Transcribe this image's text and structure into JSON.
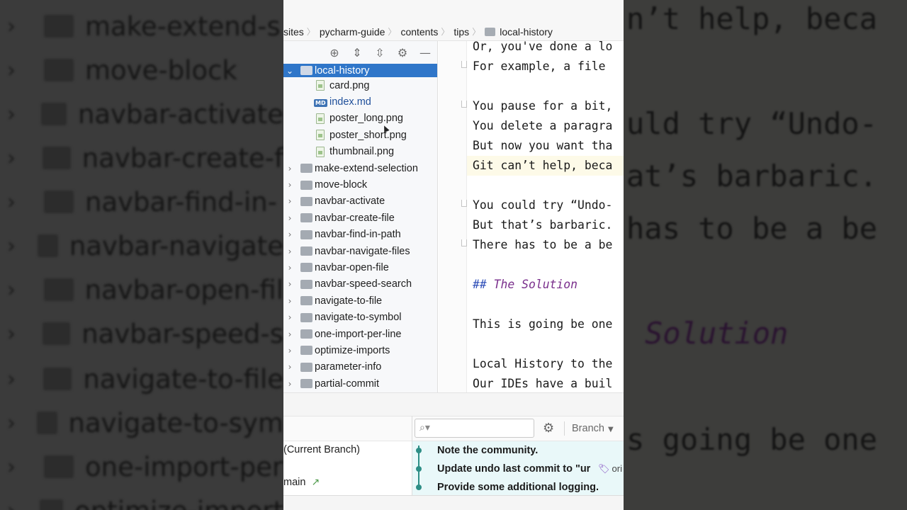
{
  "background": {
    "left_tree": [
      {
        "chevron": "›",
        "label": "make-extend-s"
      },
      {
        "chevron": "›",
        "label": "move-block"
      },
      {
        "chevron": "›",
        "label": "navbar-activate"
      },
      {
        "chevron": "›",
        "label": "navbar-create-f"
      },
      {
        "chevron": "›",
        "label": "navbar-find-in-"
      },
      {
        "chevron": "›",
        "label": "navbar-navigate"
      },
      {
        "chevron": "›",
        "label": "navbar-open-fil"
      },
      {
        "chevron": "›",
        "label": "navbar-speed-s"
      },
      {
        "chevron": "›",
        "label": "navigate-to-file"
      },
      {
        "chevron": "›",
        "label": "navigate-to-sym"
      },
      {
        "chevron": "›",
        "label": "one-import-per"
      },
      {
        "chevron": "›",
        "label": "optimize-import"
      }
    ],
    "right_code": [
      "n’t help, beca",
      "uld try “Undo-",
      "at’s barbaric.",
      "has to be a be",
      "Solution",
      "s going be one"
    ]
  },
  "breadcrumb": [
    "sites",
    "pycharm-guide",
    "contents",
    "tips",
    "local-history"
  ],
  "project_toolbar": {
    "icons": [
      "locate-icon",
      "expand-all-icon",
      "collapse-all-icon",
      "gear-icon",
      "hide-icon"
    ],
    "glyphs": [
      "⊕",
      "⇕",
      "⇳",
      "⚙",
      "—"
    ]
  },
  "tree": {
    "selected": {
      "chevron": "⌄",
      "label": "local-history"
    },
    "files": [
      {
        "label": "card.png",
        "kind": "png"
      },
      {
        "label": "index.md",
        "kind": "md",
        "badge": "MD"
      },
      {
        "label": "poster_long.png",
        "kind": "png"
      },
      {
        "label": "poster_short.png",
        "kind": "png"
      },
      {
        "label": "thumbnail.png",
        "kind": "png"
      }
    ],
    "folders": [
      {
        "chevron": "›",
        "label": "make-extend-selection"
      },
      {
        "chevron": "›",
        "label": "move-block"
      },
      {
        "chevron": "›",
        "label": "navbar-activate"
      },
      {
        "chevron": "›",
        "label": "navbar-create-file"
      },
      {
        "chevron": "›",
        "label": "navbar-find-in-path"
      },
      {
        "chevron": "›",
        "label": "navbar-navigate-files"
      },
      {
        "chevron": "›",
        "label": "navbar-open-file"
      },
      {
        "chevron": "›",
        "label": "navbar-speed-search"
      },
      {
        "chevron": "›",
        "label": "navigate-to-file"
      },
      {
        "chevron": "›",
        "label": "navigate-to-symbol"
      },
      {
        "chevron": "›",
        "label": "one-import-per-line"
      },
      {
        "chevron": "›",
        "label": "optimize-imports"
      },
      {
        "chevron": "›",
        "label": "parameter-info"
      },
      {
        "chevron": "›",
        "label": "partial-commit"
      }
    ]
  },
  "editor": {
    "lines": [
      "Or, you've done a lo",
      "For example, a file",
      "",
      "You pause for a bit,",
      "You delete a paragra",
      "But now you want tha",
      "Git can’t help, beca",
      "",
      "You could try “Undo-",
      "But that’s barbaric.",
      "There has to be a be",
      "",
      "## The Solution",
      "",
      "This is going be one",
      "",
      "Local History to the",
      "Our IDEs have a buil"
    ],
    "heading": {
      "hash": "##",
      "text": " The Solution"
    }
  },
  "git_log": {
    "search_placeholder": "",
    "search_glyph": "⌕▾",
    "gear_glyph": "⚙",
    "branch_label": "Branch",
    "branch_arrow": "▼",
    "branches": [
      {
        "label": "(Current Branch)"
      },
      {
        "label": "main",
        "arrow": "↗"
      }
    ],
    "commits": [
      {
        "message": "Note the community."
      },
      {
        "message": "Update undo last commit to \"ur",
        "tag": "ori",
        "tag_glyph": "🏷"
      },
      {
        "message": "Provide some additional logging."
      }
    ]
  }
}
